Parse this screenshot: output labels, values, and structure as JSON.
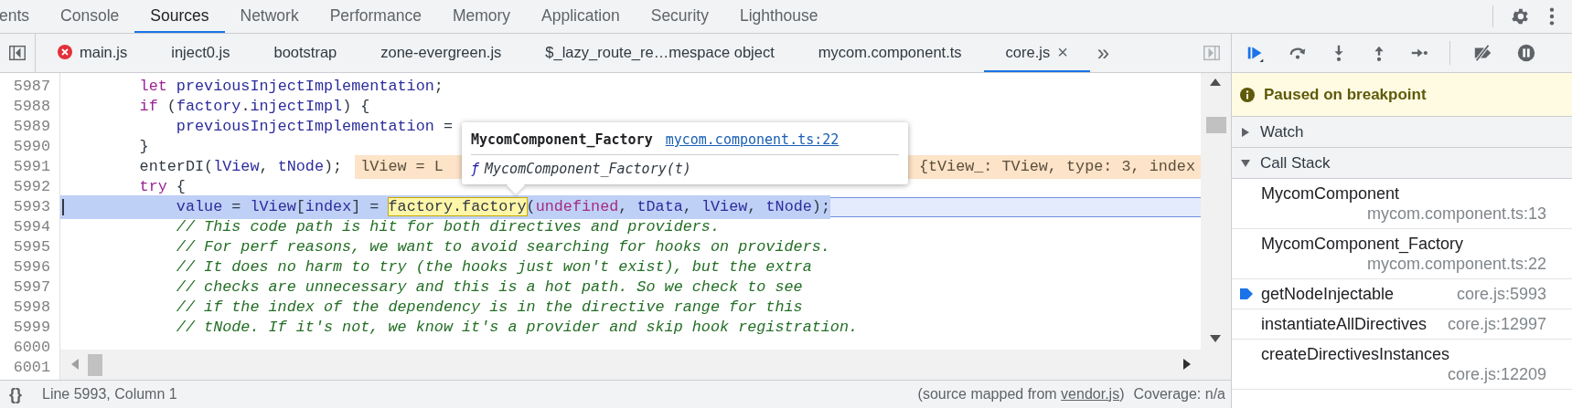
{
  "main_tabs": [
    {
      "label": "ents",
      "selected": false
    },
    {
      "label": "Console",
      "selected": false
    },
    {
      "label": "Sources",
      "selected": true
    },
    {
      "label": "Network",
      "selected": false
    },
    {
      "label": "Performance",
      "selected": false
    },
    {
      "label": "Memory",
      "selected": false
    },
    {
      "label": "Application",
      "selected": false
    },
    {
      "label": "Security",
      "selected": false
    },
    {
      "label": "Lighthouse",
      "selected": false
    }
  ],
  "file_tabs": [
    {
      "label": "main.js",
      "error": true,
      "selected": false
    },
    {
      "label": "inject0.js",
      "error": false,
      "selected": false
    },
    {
      "label": "bootstrap",
      "error": false,
      "selected": false
    },
    {
      "label": "zone-evergreen.js",
      "error": false,
      "selected": false
    },
    {
      "label": "$_lazy_route_re…mespace object",
      "error": false,
      "selected": false
    },
    {
      "label": "mycom.component.ts",
      "error": false,
      "selected": false
    },
    {
      "label": "core.js",
      "error": false,
      "selected": true,
      "close": "×"
    }
  ],
  "file_tabs_overflow": "»",
  "editor": {
    "lines": [
      {
        "number": "5987",
        "selected": false,
        "tokens": [
          {
            "kind": "keyword",
            "t": "        let"
          },
          {
            "kind": "variable",
            "t": " previousInjectImplementation"
          },
          {
            "kind": "plain",
            "t": ";"
          }
        ]
      },
      {
        "number": "5988",
        "selected": false,
        "tokens": [
          {
            "kind": "keyword",
            "t": "        if"
          },
          {
            "kind": "plain",
            "t": " ("
          },
          {
            "kind": "variable",
            "t": "factory"
          },
          {
            "kind": "plain",
            "t": "."
          },
          {
            "kind": "variable",
            "t": "injectImpl"
          },
          {
            "kind": "plain",
            "t": ") {"
          }
        ]
      },
      {
        "number": "5989",
        "selected": false,
        "tokens": [
          {
            "kind": "variable",
            "t": "            previousInjectImplementation"
          },
          {
            "kind": "plain",
            "t": " ="
          }
        ]
      },
      {
        "number": "5990",
        "selected": false,
        "tokens": [
          {
            "kind": "plain",
            "t": "        }"
          }
        ]
      },
      {
        "number": "5991",
        "selected": false,
        "tokens": [
          {
            "kind": "plain",
            "t": "        enterDI("
          },
          {
            "kind": "variable",
            "t": "lView"
          },
          {
            "kind": "plain",
            "t": ", "
          },
          {
            "kind": "variable",
            "t": "tNode"
          },
          {
            "kind": "plain",
            "t": ");"
          }
        ],
        "inline_value": [
          "lView = L",
          "{tView_: TView, type: 3, index"
        ]
      },
      {
        "number": "5992",
        "selected": false,
        "tokens": [
          {
            "kind": "keyword",
            "t": "        try"
          },
          {
            "kind": "plain",
            "t": " {"
          }
        ]
      },
      {
        "number": "5993",
        "selected": true,
        "tokens": [
          {
            "kind": "variable",
            "t": "            value"
          },
          {
            "kind": "plain",
            "t": " = "
          },
          {
            "kind": "variable",
            "t": "lView"
          },
          {
            "kind": "plain",
            "t": "["
          },
          {
            "kind": "variable",
            "t": "index"
          },
          {
            "kind": "plain",
            "t": "] = "
          },
          {
            "kind": "hovered",
            "t": "factory.factory"
          },
          {
            "kind": "plain",
            "t": "("
          },
          {
            "kind": "literal",
            "t": "undefined"
          },
          {
            "kind": "plain",
            "t": ", "
          },
          {
            "kind": "variable",
            "t": "tData"
          },
          {
            "kind": "plain",
            "t": ", "
          },
          {
            "kind": "variable",
            "t": "lView"
          },
          {
            "kind": "plain",
            "t": ", "
          },
          {
            "kind": "variable",
            "t": "tNode"
          },
          {
            "kind": "plain",
            "t": ");"
          }
        ]
      },
      {
        "number": "5994",
        "selected": false,
        "tokens": [
          {
            "kind": "comment",
            "t": "            // This code path is hit for both directives and providers."
          }
        ]
      },
      {
        "number": "5995",
        "selected": false,
        "tokens": [
          {
            "kind": "comment",
            "t": "            // For perf reasons, we want to avoid searching for hooks on providers."
          }
        ]
      },
      {
        "number": "5996",
        "selected": false,
        "tokens": [
          {
            "kind": "comment",
            "t": "            // It does no harm to try (the hooks just won't exist), but the extra"
          }
        ]
      },
      {
        "number": "5997",
        "selected": false,
        "tokens": [
          {
            "kind": "comment",
            "t": "            // checks are unnecessary and this is a hot path. So we check to see"
          }
        ]
      },
      {
        "number": "5998",
        "selected": false,
        "tokens": [
          {
            "kind": "comment",
            "t": "            // if the index of the dependency is in the directive range for this"
          }
        ]
      },
      {
        "number": "5999",
        "selected": false,
        "tokens": [
          {
            "kind": "comment",
            "t": "            // tNode. If it's not, we know it's a provider and skip hook registration."
          }
        ]
      }
    ],
    "gutter_extra": [
      "6000",
      "6001"
    ]
  },
  "tooltip": {
    "title": "MycomComponent_Factory",
    "link": "mycom.component.ts:22",
    "signature_icon": "ƒ",
    "signature": "MycomComponent_Factory(t)"
  },
  "status_bar": {
    "pretty_print": "{}",
    "cursor": "Line 5993, Column 1",
    "source_prefix": "(source mapped from ",
    "source_link": "vendor.js",
    "source_suffix": ")",
    "coverage": "Coverage: n/a"
  },
  "debugger": {
    "banner": "Paused on breakpoint",
    "sections": [
      {
        "label": "Watch",
        "expanded": false
      },
      {
        "label": "Call Stack",
        "expanded": true
      }
    ],
    "call_stack": [
      {
        "name": "MycomComponent",
        "location": "mycom.component.ts:13",
        "selected": false
      },
      {
        "name": "MycomComponent_Factory",
        "location": "mycom.component.ts:22",
        "selected": false
      },
      {
        "name": "getNodeInjectable",
        "location": "core.js:5993",
        "selected": true
      },
      {
        "name": "instantiateAllDirectives",
        "location": "core.js:12997",
        "selected": false
      },
      {
        "name": "createDirectivesInstances",
        "location": "core.js:12209",
        "selected": false
      }
    ]
  }
}
